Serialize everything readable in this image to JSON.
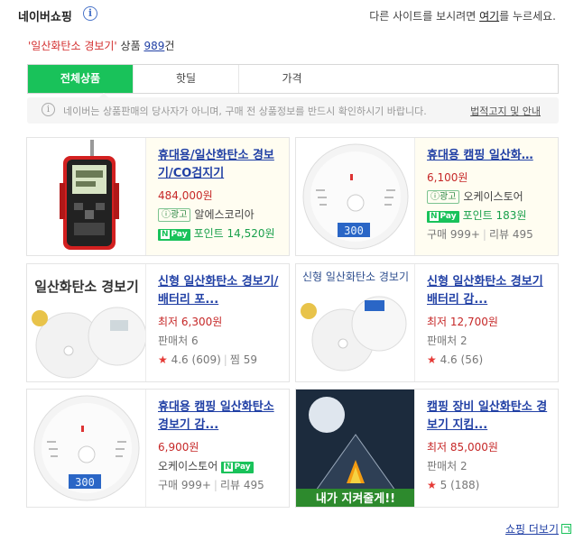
{
  "header": {
    "brand": "네이버쇼핑",
    "switch_prefix": "다른 사이트를 보시려면 ",
    "switch_link": "여기",
    "switch_suffix": "를 누르세요."
  },
  "summary": {
    "query": "'일산화탄소 경보기'",
    "products_label": " 상품 ",
    "count": "989",
    "count_suffix": "건"
  },
  "tabs": [
    {
      "label": "전체상품",
      "active": true
    },
    {
      "label": "핫딜",
      "active": false
    },
    {
      "label": "가격",
      "active": false
    }
  ],
  "notice": {
    "text": "네이버는 상품판매의 당사자가 아니며, 구매 전 상품정보를 반드시 확인하시기 바랍니다.",
    "link": "법적고지 및 안내"
  },
  "products": [
    {
      "title_pre": "휴대용/일산화탄소 경보기/CO검지기",
      "price": "484,000원",
      "ad_badge": "광고",
      "seller": "알에스코리아",
      "npay": "Pay",
      "points": "포인트 14,520원"
    },
    {
      "title_pre": "휴대용 캠핑 일산화…",
      "price": "6,100원",
      "ad_badge": "광고",
      "seller": "오케이스토어",
      "npay": "Pay",
      "points": "포인트 183원",
      "purchases": "구매",
      "purchases_count": "999+",
      "reviews": "리뷰",
      "reviews_count": "495"
    },
    {
      "title_pre": "신형 일산화탄소 경보기/배터리 포...",
      "price": "최저 6,300원",
      "sellers": "판매처",
      "sellers_count": "6",
      "rating": "4.6",
      "rating_count": "(609)",
      "wish": "찜",
      "wish_count": "59"
    },
    {
      "title_pre": "신형 일산화탄소 경보기 배터리 감...",
      "price": "최저 12,700원",
      "sellers": "판매처",
      "sellers_count": "2",
      "rating": "4.6",
      "rating_count": "(56)"
    },
    {
      "title_pre": "휴대용 캠핑 일산화탄소 경보기 감...",
      "price": "6,900원",
      "seller": "오케이스토어",
      "npay": "Pay",
      "purchases": "구매",
      "purchases_count": "999+",
      "reviews": "리뷰",
      "reviews_count": "495"
    },
    {
      "title_pre": "캠핑 장비 일산화탄소 경보기 지킴...",
      "price": "최저 85,000원",
      "sellers": "판매처",
      "sellers_count": "2",
      "rating": "5",
      "rating_count": "(188)"
    }
  ],
  "thumb_texts": {
    "p3_banner": "일산화탄소 경보기",
    "p4_banner": "신형 일산화탄소 경보기",
    "p6_banner": "내가 지켜줄게!!",
    "display_value": "300"
  },
  "more": {
    "label": "쇼핑 더보기"
  },
  "colors": {
    "accent_green": "#19c25a",
    "link_blue": "#2140a5",
    "price_red": "#c62828"
  }
}
